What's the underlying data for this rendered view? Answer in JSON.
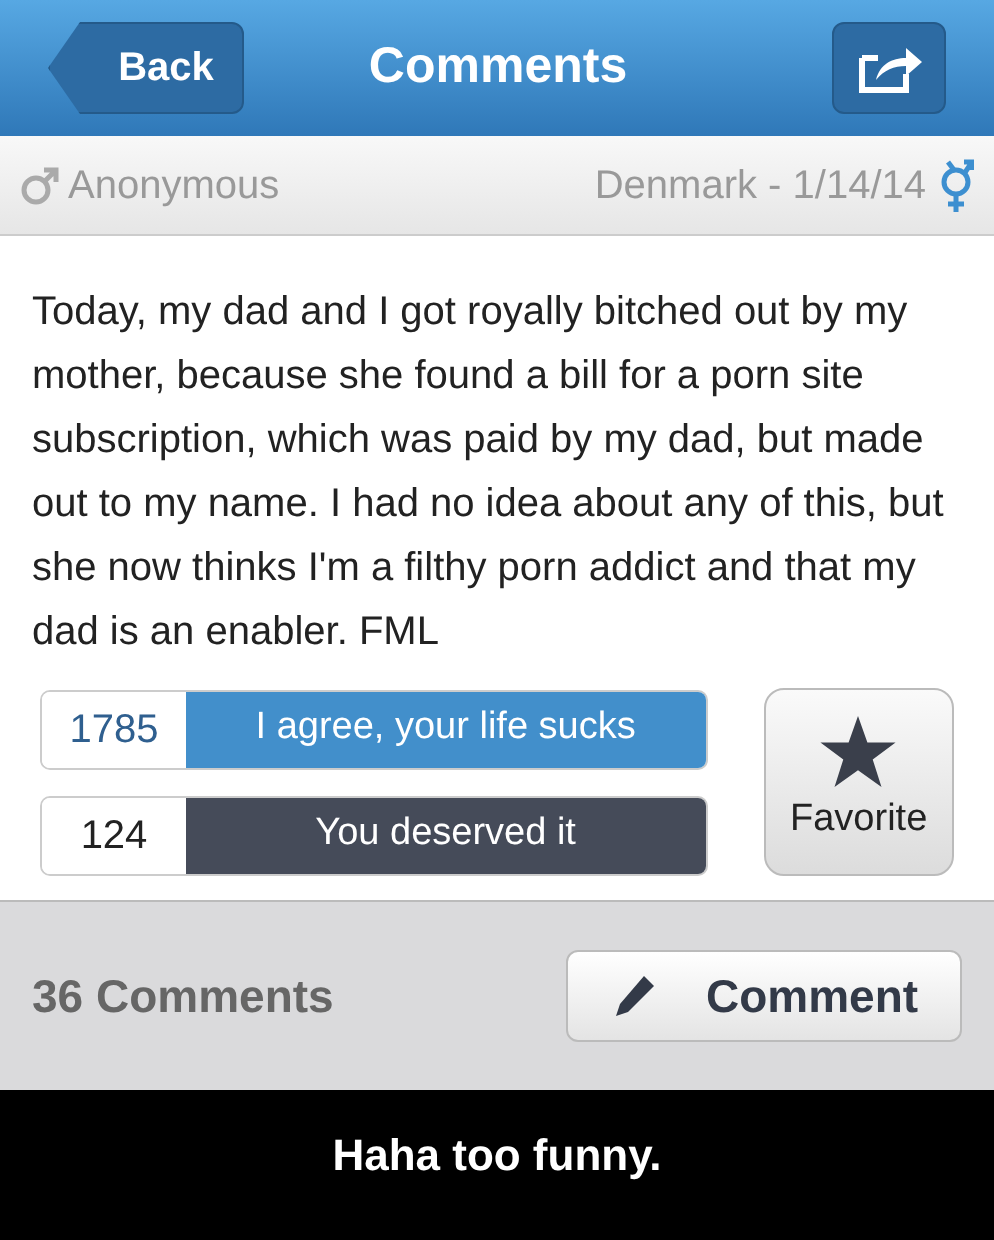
{
  "header": {
    "back": "Back",
    "title": "Comments"
  },
  "author": {
    "name": "Anonymous",
    "location_date": "Denmark - 1/14/14"
  },
  "story": "Today, my dad and I got royally bitched out by my mother, because she found a bill for a porn site subscription, which was paid by my dad, but made out to my name. I had no idea about any of this, but she now thinks I'm a filthy porn addict and that my dad is an enabler. FML",
  "votes": [
    {
      "kind": "agree",
      "count": "1785",
      "label": "I agree, your life sucks"
    },
    {
      "kind": "deserved",
      "count": "124",
      "label": "You deserved it"
    }
  ],
  "favorite": "Favorite",
  "footer": {
    "count": "36 Comments",
    "button": "Comment"
  },
  "caption": "Haha too funny."
}
